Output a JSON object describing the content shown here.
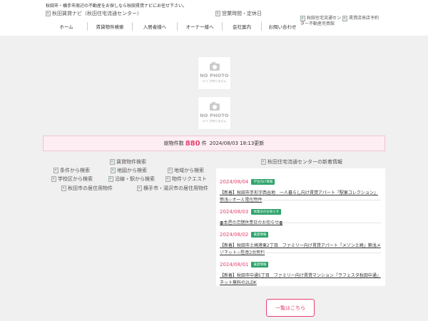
{
  "header": {
    "tagline": "秋田市・横手市周辺の不動産をお探しなら秋田賃貸ナビにお任せ下さい。",
    "logo_alt": "秋田賃貸ナビ（秋田住宅流通センター）",
    "hours_alt": "営業時間・定休日",
    "nav": [
      "ホーム",
      "賃貸物件検索",
      "入居者様へ",
      "オーナー様へ",
      "会社案内",
      "お問い合わせ"
    ],
    "side_link_1": "秋田住宅流通センター不動産売買館",
    "side_link_2": "賃貸店来店予約"
  },
  "photos": [
    {
      "label": "NO PHOTO",
      "sub": "ｲﾒｰｼﾞが有りません"
    },
    {
      "label": "NO PHOTO",
      "sub": "ｲﾒｰｼﾞが有りません"
    }
  ],
  "count": {
    "prefix": "総物件数",
    "number": "880",
    "suffix": "件",
    "updated": "2024/08/03 18:13更新"
  },
  "search": {
    "title_alt": "賃貸物件検索",
    "links": [
      "条件から検索",
      "地図から検索",
      "地域から検索",
      "学校区から検索",
      "沿線・駅から検索",
      "物件リクエスト",
      "秋田市の居住用物件",
      "横手市・湯沢市の居住用物件"
    ]
  },
  "news": {
    "title_alt": "秋田住宅流通センターの新着情報",
    "items": [
      {
        "date": "2024/08/04",
        "badge": "学生向け情報",
        "text": "【新着】秋田市手形字西谷地　一人暮らし向け賃貸アパート『駅東コレクション』築浅☆オール電化物件"
      },
      {
        "date": "2024/08/03",
        "badge": "休業日のお知らせ",
        "text": "●本週の店舗休業日のお知らせ●"
      },
      {
        "date": "2024/08/02",
        "badge": "賃貸情報",
        "text": "【新着】秋田市土崎港東2丁目　ファミリー向け賃貸アパート『メゾン土崎』築浅メゾネット☆駐車2台無料"
      },
      {
        "date": "2024/08/01",
        "badge": "賃貸情報",
        "text": "【新着】秋田市中通5丁目　ファミリー向け賃貸マンション『ラフェスタ秋田中通』ネット無料の2LDK"
      }
    ],
    "more_label": "一覧はこちら"
  }
}
